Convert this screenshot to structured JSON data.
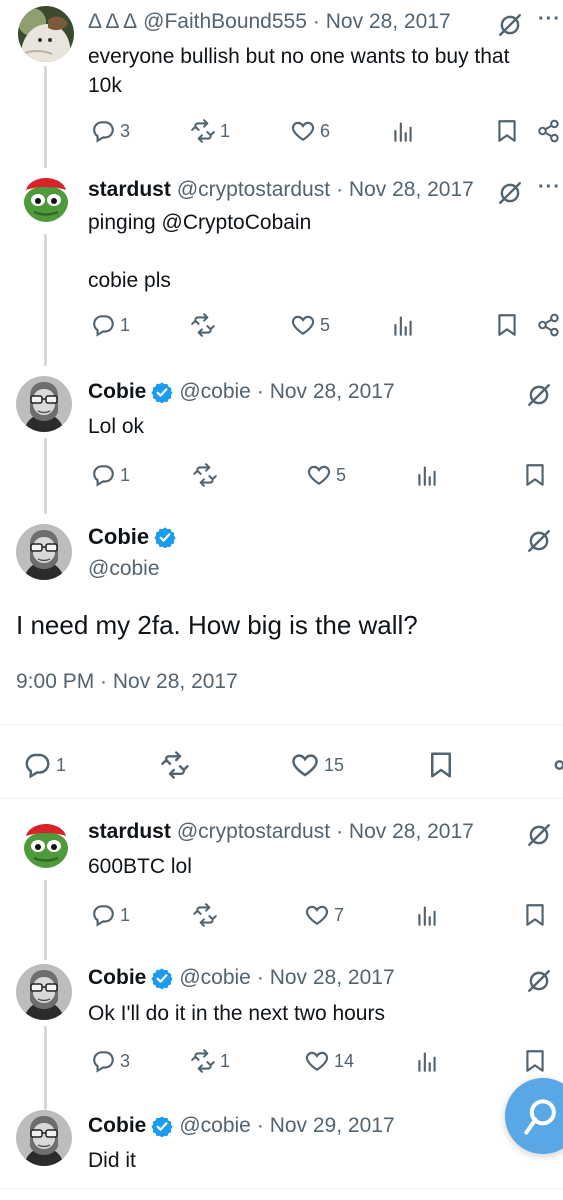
{
  "tweets": [
    {
      "name": "Δ Δ Δ",
      "handle": "@FaithBound555",
      "date": "· Nov 28, 2017",
      "text": "everyone bullish but no one wants to buy that\n10k",
      "replies": "3",
      "retweets": "1",
      "likes": "6"
    },
    {
      "name": "stardust",
      "handle": "@cryptostardust",
      "date": "· Nov 28, 2017",
      "text": "pinging @CryptoCobain\n\ncobie pls",
      "replies": "1",
      "retweets": "",
      "likes": "5"
    },
    {
      "name": "Cobie",
      "handle": "@cobie",
      "date": "· Nov 28, 2017",
      "text": "Lol ok",
      "replies": "1",
      "retweets": "",
      "likes": "5"
    }
  ],
  "main_tweet": {
    "name": "Cobie",
    "handle": "@cobie",
    "text": "I need my 2fa. How big is the wall?",
    "timestamp": "9:00 PM · Nov 28, 2017",
    "replies": "1",
    "likes": "15"
  },
  "replies": [
    {
      "name": "stardust",
      "handle": "@cryptostardust",
      "date": "· Nov 28, 2017",
      "text": "600BTC lol",
      "replies": "1",
      "retweets": "",
      "likes": "7"
    },
    {
      "name": "Cobie",
      "handle": "@cobie",
      "date": "· Nov 28, 2017",
      "text": "Ok I'll do it in the next two hours",
      "replies": "3",
      "retweets": "1",
      "likes": "14"
    },
    {
      "name": "Cobie",
      "handle": "@cobie",
      "date": "· Nov 29, 2017",
      "text": "Did it"
    }
  ],
  "more_label": "···",
  "colors": {
    "text": "#0f1419",
    "secondary": "#536471",
    "verified": "#1d9bf0",
    "fab": "#5aa7e6",
    "line": "#cfd9de"
  }
}
